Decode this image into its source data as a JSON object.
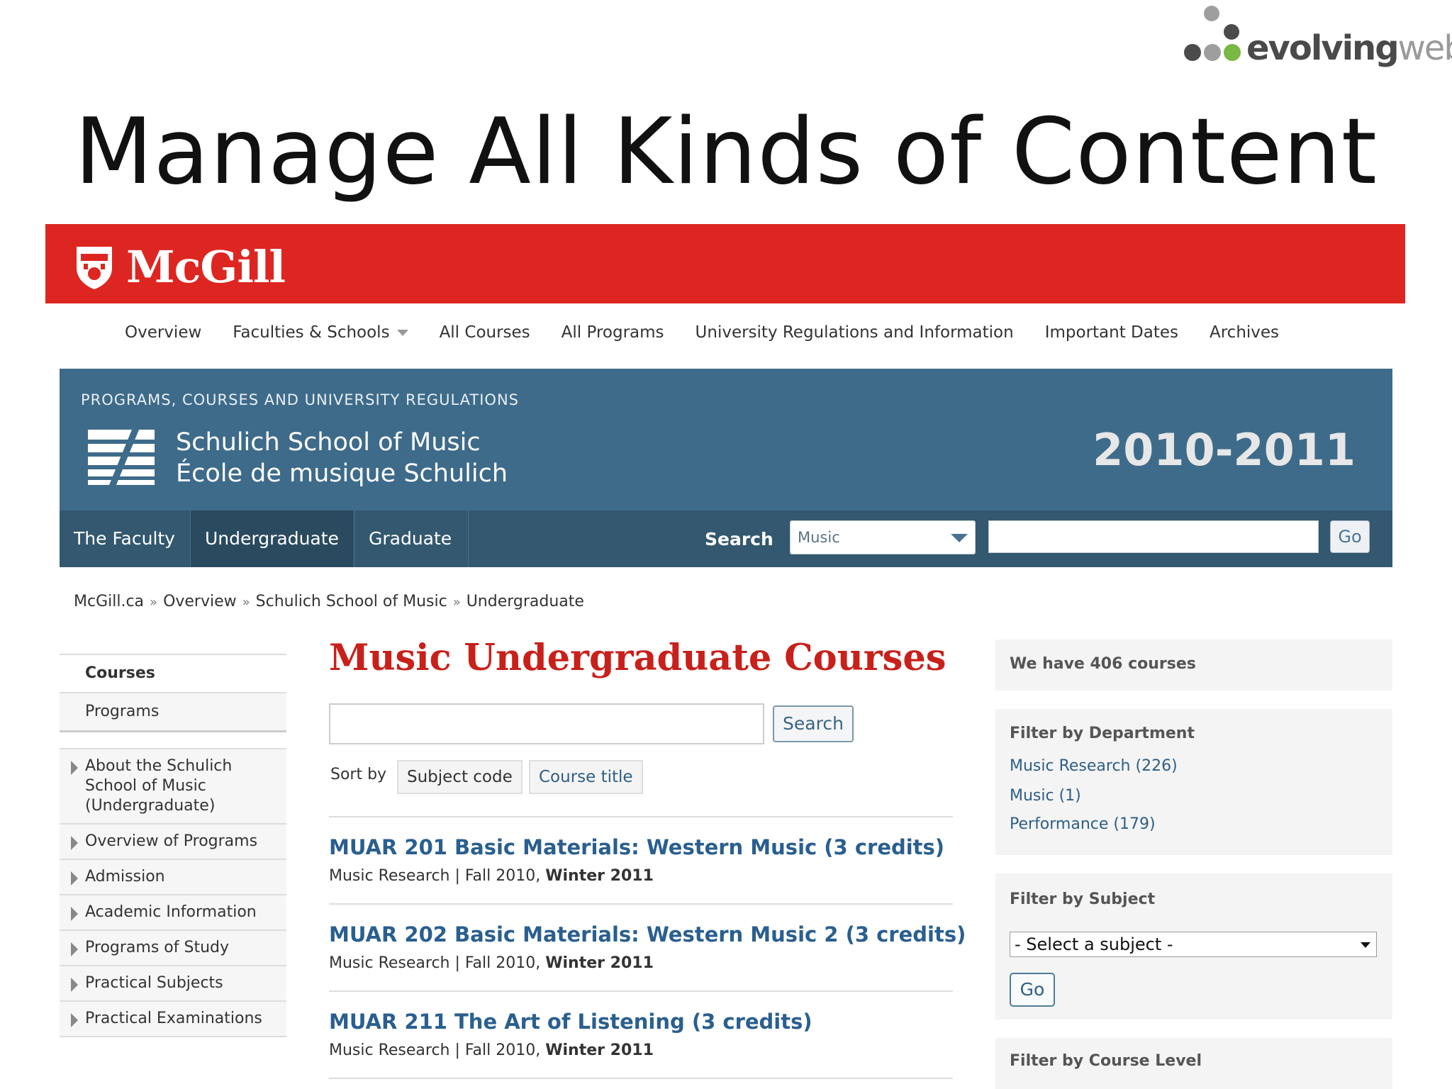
{
  "slide": {
    "brand": {
      "word_dark": "evolving",
      "word_light": "web"
    },
    "title": "Manage All Kinds of Content"
  },
  "mcgill": {
    "name": "McGill"
  },
  "topnav": {
    "items": [
      "Overview",
      "Faculties & Schools",
      "All Courses",
      "All Programs",
      "University Regulations and Information",
      "Important Dates",
      "Archives"
    ]
  },
  "header": {
    "kicker": "PROGRAMS, COURSES AND UNIVERSITY REGULATIONS",
    "school_en": "Schulich School of Music",
    "school_fr": "École de musique Schulich",
    "year": "2010-2011"
  },
  "subnav": {
    "tabs": [
      "The Faculty",
      "Undergraduate",
      "Graduate"
    ],
    "search_label": "Search",
    "select_value": "Music",
    "go_label": "Go"
  },
  "breadcrumb": [
    "McGill.ca",
    "Overview",
    "Schulich School of Music",
    "Undergraduate"
  ],
  "sidebar": {
    "tabs": [
      "Courses",
      "Programs"
    ],
    "items": [
      "About the Schulich School of Music (Undergraduate)",
      "Overview of Programs",
      "Admission",
      "Academic Information",
      "Programs of Study",
      "Practical Subjects",
      "Practical Examinations"
    ]
  },
  "main": {
    "title": "Music Undergraduate Courses",
    "search_button": "Search",
    "sort_label": "Sort by",
    "sort_options": [
      "Subject code",
      "Course title"
    ],
    "courses": [
      {
        "title": "MUAR 201 Basic Materials: Western Music (3 credits)",
        "dept": "Music Research",
        "terms": "Fall 2010,",
        "term_bold": "Winter 2011"
      },
      {
        "title": "MUAR 202 Basic Materials: Western Music 2 (3 credits)",
        "dept": "Music Research",
        "terms": "Fall 2010,",
        "term_bold": "Winter 2011"
      },
      {
        "title": "MUAR 211 The Art of Listening (3 credits)",
        "dept": "Music Research",
        "terms": "Fall 2010,",
        "term_bold": "Winter 2011"
      }
    ]
  },
  "right": {
    "count_text": "We have 406 courses",
    "dept_heading": "Filter by Department",
    "departments": [
      "Music Research (226)",
      "Music (1)",
      "Performance (179)"
    ],
    "subject_heading": "Filter by Subject",
    "subject_select": "- Select a subject -",
    "go_label": "Go",
    "level_heading": "Filter by Course Level"
  },
  "colors": {
    "mcgill_red": "#dd2621",
    "header_blue": "#3e6b8a",
    "nav_blue": "#33586f",
    "title_red": "#c8201b",
    "link_blue": "#2a5f8f"
  },
  "icons": [
    "mcgill-crest-icon",
    "schulich-logo-icon",
    "dropdown-caret-icon",
    "sidebar-triangle-icon"
  ]
}
